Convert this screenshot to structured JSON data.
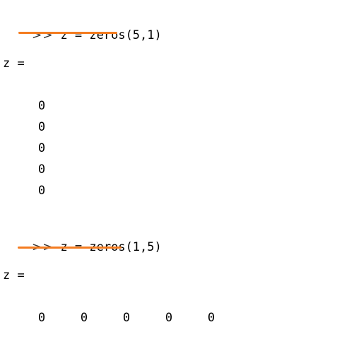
{
  "accent_color": "#F47C20",
  "blocks": [
    {
      "prompt": ">>",
      "command": "z = zeros(5,1)",
      "output_var": "z =",
      "values": [
        "0",
        "0",
        "0",
        "0",
        "0"
      ],
      "orientation": "column"
    },
    {
      "prompt": ">>",
      "command": "z = zeros(1,5)",
      "output_var": "z =",
      "values": [
        "0",
        "0",
        "0",
        "0",
        "0"
      ],
      "orientation": "row"
    }
  ]
}
